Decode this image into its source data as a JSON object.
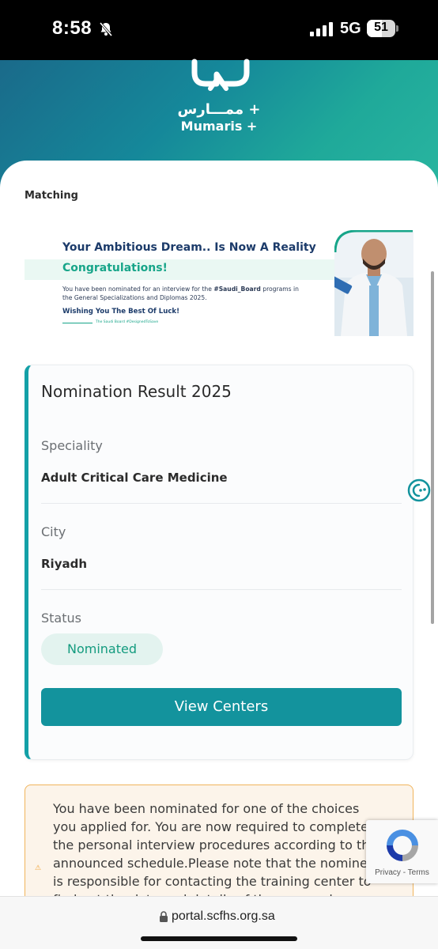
{
  "status_bar": {
    "time": "8:58",
    "network": "5G",
    "battery_level": "51",
    "icons": [
      "bell-slash-icon",
      "signal-icon",
      "battery-icon"
    ]
  },
  "header": {
    "logo_arabic": "ممـــارس +",
    "logo_english": "Mumaris +",
    "gradient_colors": [
      "#1a6a8a",
      "#2ab6a0"
    ]
  },
  "section": {
    "label": "Matching"
  },
  "banner": {
    "title": "Your Ambitious Dream.. Is Now A Reality",
    "congrats": "Congratulations!",
    "body_prefix": "You have been nominated for an interview for the ",
    "body_hashtag": "#Saudi_Board",
    "body_suffix": " programs in the General Specializations and Diplomas 2025.",
    "wish": "Wishing You The Best Of Luck!",
    "tagline": "The Saudi Board #DesignedToSave"
  },
  "result": {
    "title": "Nomination Result 2025",
    "speciality_label": "Speciality",
    "speciality_value": "Adult Critical Care Medicine",
    "city_label": "City",
    "city_value": "Riyadh",
    "status_label": "Status",
    "status_value": "Nominated",
    "button_label": "View Centers"
  },
  "notice": {
    "text": "You have been nominated for one of the choices you applied for. You are now required to complete the personal interview procedures according to the announced schedule.Please note that the nominee is responsible for contacting the training center to find out the date and details of the personal interview or attending"
  },
  "recaptcha": {
    "privacy": "Privacy",
    "separator": " - ",
    "terms": "Terms"
  },
  "browser": {
    "url": "portal.scfhs.org.sa"
  },
  "colors": {
    "accent": "#13939d",
    "success": "#149b7f",
    "warning_border": "#f0b45c"
  }
}
